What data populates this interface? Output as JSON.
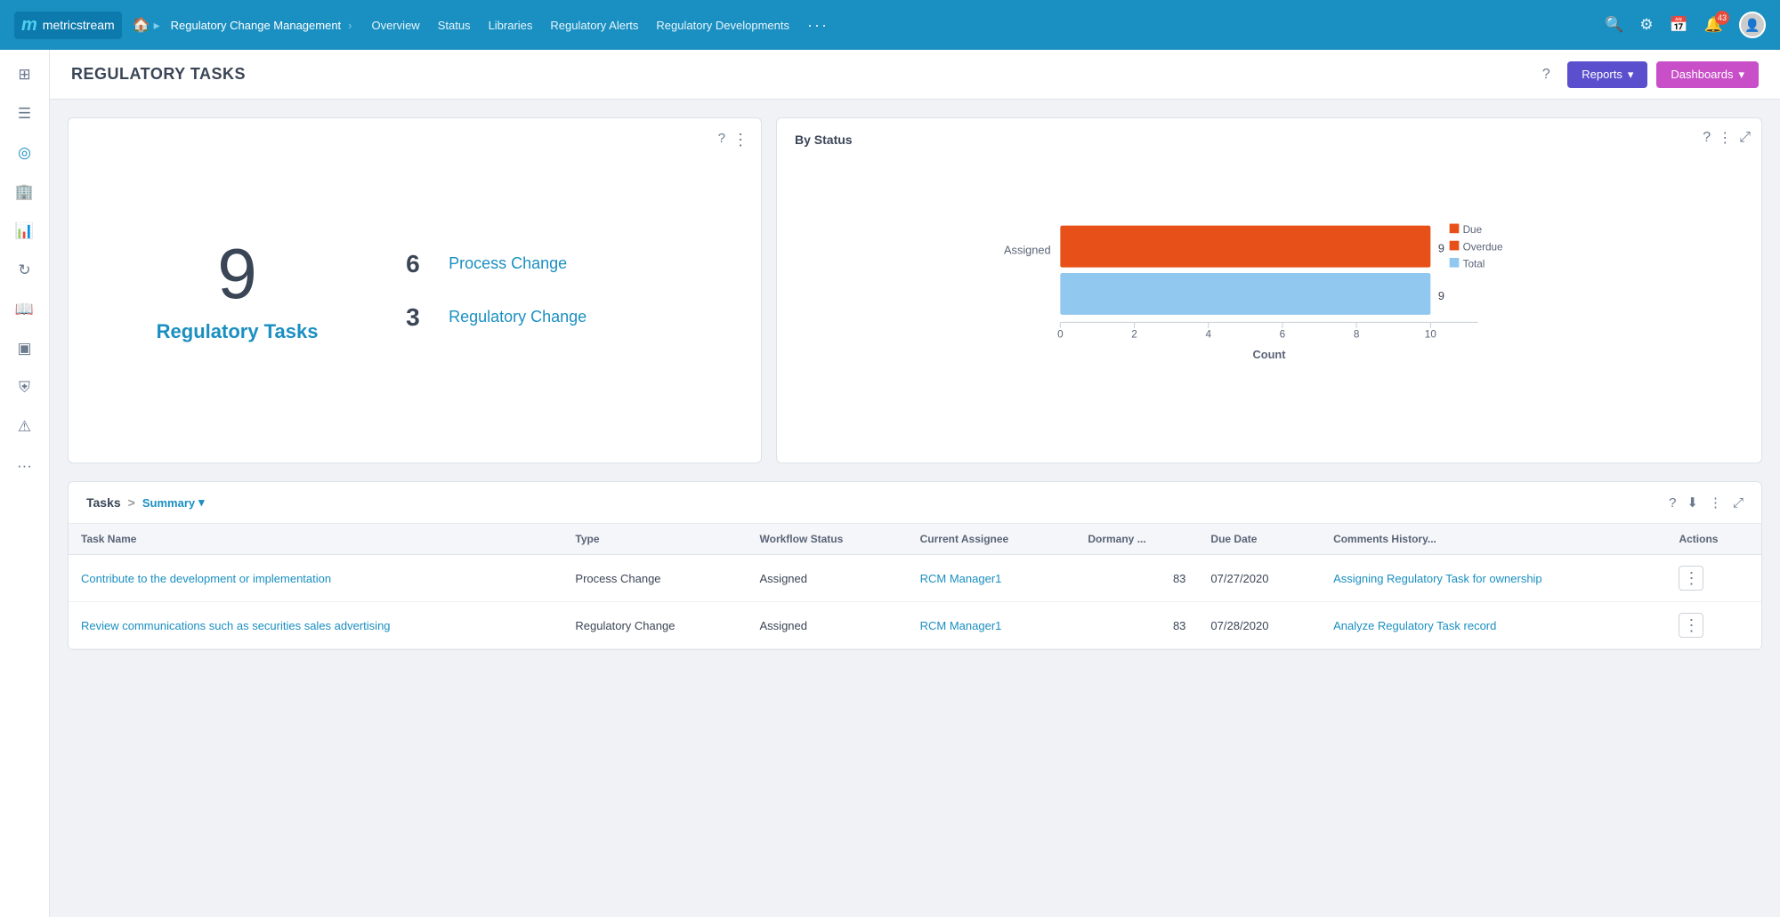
{
  "topNav": {
    "logo": {
      "mLetter": "m",
      "brandName": "metricstream"
    },
    "breadcrumb": {
      "home": "⌂",
      "module": "Regulatory Change Management"
    },
    "navLinks": [
      {
        "label": "Overview",
        "id": "overview"
      },
      {
        "label": "Status",
        "id": "status"
      },
      {
        "label": "Libraries",
        "id": "libraries"
      },
      {
        "label": "Regulatory Alerts",
        "id": "regulatory-alerts"
      },
      {
        "label": "Regulatory Developments",
        "id": "regulatory-developments"
      }
    ],
    "moreLabel": "···",
    "badgeCount": "43"
  },
  "sidebar": {
    "icons": [
      {
        "name": "home-icon",
        "symbol": "⊞"
      },
      {
        "name": "list-icon",
        "symbol": "☰"
      },
      {
        "name": "gauge-icon",
        "symbol": "◎"
      },
      {
        "name": "building-icon",
        "symbol": "🏢"
      },
      {
        "name": "chart-icon",
        "symbol": "📊"
      },
      {
        "name": "refresh-icon",
        "symbol": "↻"
      },
      {
        "name": "book-icon",
        "symbol": "📖"
      },
      {
        "name": "grid-icon",
        "symbol": "⊞"
      },
      {
        "name": "shield-icon",
        "symbol": "⛨"
      },
      {
        "name": "alert-icon",
        "symbol": "⚠"
      },
      {
        "name": "more-icon",
        "symbol": "···"
      }
    ]
  },
  "pageHeader": {
    "title": "REGULATORY TASKS",
    "helpTooltip": "?",
    "reportsLabel": "Reports",
    "reportsDropIcon": "▾",
    "dashboardsLabel": "Dashboards",
    "dashboardsDropIcon": "▾"
  },
  "tasksWidget": {
    "bigNumber": "9",
    "tasksLabel": "Regulatory Tasks",
    "breakdown": [
      {
        "count": "6",
        "label": "Process Change"
      },
      {
        "count": "3",
        "label": "Regulatory Change"
      }
    ]
  },
  "chart": {
    "title": "By Status",
    "xAxisLabel": "Count",
    "xTicks": [
      "0",
      "2",
      "4",
      "6",
      "8",
      "10"
    ],
    "yLabels": [
      "Assigned"
    ],
    "bars": [
      {
        "label": "Assigned",
        "bars": [
          {
            "color": "#e8501a",
            "value": 9,
            "max": 10,
            "name": "Due"
          },
          {
            "color": "#90c8f0",
            "value": 9,
            "max": 10,
            "name": "Total"
          }
        ]
      }
    ],
    "legend": [
      {
        "color": "#e8501a",
        "label": "Due"
      },
      {
        "color": "#e8501a",
        "label": "Overdue"
      },
      {
        "color": "#90c8f0",
        "label": "Total"
      }
    ],
    "dataValues": [
      {
        "bar": "Due",
        "val": 9
      },
      {
        "bar": "Total",
        "val": 9
      }
    ]
  },
  "tableSection": {
    "titleLabel": "Tasks",
    "breadcrumbSep": ">",
    "summaryLabel": "Summary",
    "summaryDropIcon": "▾",
    "columns": [
      {
        "key": "taskName",
        "label": "Task Name"
      },
      {
        "key": "type",
        "label": "Type"
      },
      {
        "key": "workflowStatus",
        "label": "Workflow Status"
      },
      {
        "key": "currentAssignee",
        "label": "Current Assignee"
      },
      {
        "key": "dormancy",
        "label": "Dormany ..."
      },
      {
        "key": "dueDate",
        "label": "Due Date"
      },
      {
        "key": "commentsHistory",
        "label": "Comments History..."
      },
      {
        "key": "actions",
        "label": "Actions"
      }
    ],
    "rows": [
      {
        "taskName": "Contribute to the development or implementation",
        "type": "Process Change",
        "workflowStatus": "Assigned",
        "currentAssignee": "RCM Manager1",
        "dormancy": "83",
        "dueDate": "07/27/2020",
        "commentsHistory": "Assigning Regulatory Task for ownership",
        "actions": "⋮"
      },
      {
        "taskName": "Review communications such as securities sales advertising",
        "type": "Regulatory Change",
        "workflowStatus": "Assigned",
        "currentAssignee": "RCM Manager1",
        "dormancy": "83",
        "dueDate": "07/28/2020",
        "commentsHistory": "Analyze Regulatory Task record",
        "actions": "⋮"
      }
    ]
  }
}
